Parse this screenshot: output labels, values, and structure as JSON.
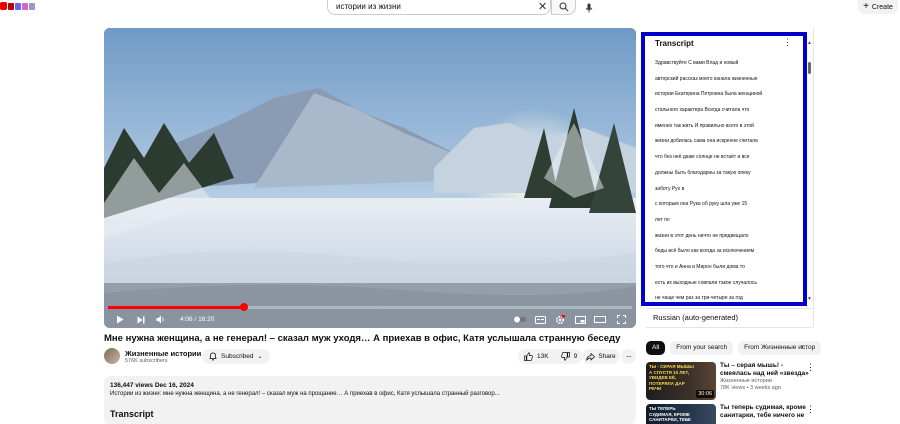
{
  "header": {
    "search_value": "истории из жизни",
    "clear_icon": "close-icon",
    "search_icon": "search-icon",
    "mic_icon": "mic-icon",
    "create_label": "Create"
  },
  "player": {
    "time": "4:06 / 16:20",
    "progress": 0.26,
    "accent": "#ff0000"
  },
  "video": {
    "title": "Мне нужна женщина, а не генерал! – сказал муж уходя… А приехав в офис, Катя услышала странную беседу",
    "channel": "Жизненные истории",
    "subscribers": "576K subscribers",
    "subscribed_label": "Subscribed",
    "likes": "13K",
    "dislikes": "9",
    "share_label": "Share"
  },
  "description": {
    "meta": "136,447 views  Dec 16, 2024",
    "text": "Истории из жизни: мне нужна женщина, а не генерал! – сказал муж на прощание… А приехав в офис, Катя услышала странный разговор...",
    "heading": "Transcript"
  },
  "transcript": {
    "title": "Transcript",
    "language": "Russian (auto-generated)",
    "lines": [
      "Здравствуйте С вами Влад и новый",
      "авторский рассказ моего канала жизненные",
      "истории Екатерина Петровна была женщиной",
      "стального характера Всегда считала что",
      "именно так жить И правильно всего в этой",
      "жизни добилась сама она искренне считала",
      "что без неё даже солнце не встаёт и все",
      "должны быть благодарны за такую опеку",
      "заботу Рух в",
      "с которым она Рука об руку шла уже 15",
      "лет по",
      "жизни в этот день ничто не предвещало",
      "беды всё было как всегда за исключением",
      "того что и Анна и Мирон были дома то",
      "есть их выходные совпали такое случалось",
      "не чаще чем раз за три-четыре за год"
    ]
  },
  "chips": [
    "All",
    "From your search",
    "From Жизненные истор"
  ],
  "recommendations": [
    {
      "title": "Ты – серая мышь! - смеялась над ней «звезда» класса… А",
      "channel": "Жизненные истории",
      "meta": "78K views • 3 weeks ago",
      "duration": "30:06",
      "thumb_text": "Ты - серая мышь! А спустя 10 лет, увидев её, потеряла дар речи"
    },
    {
      "title": "Ты теперь судимая, кроме санитарки, тебе ничего не",
      "channel": "",
      "meta": "",
      "duration": "",
      "thumb_text": "Ты теперь судимая, кроме санитарки, тебе"
    }
  ]
}
